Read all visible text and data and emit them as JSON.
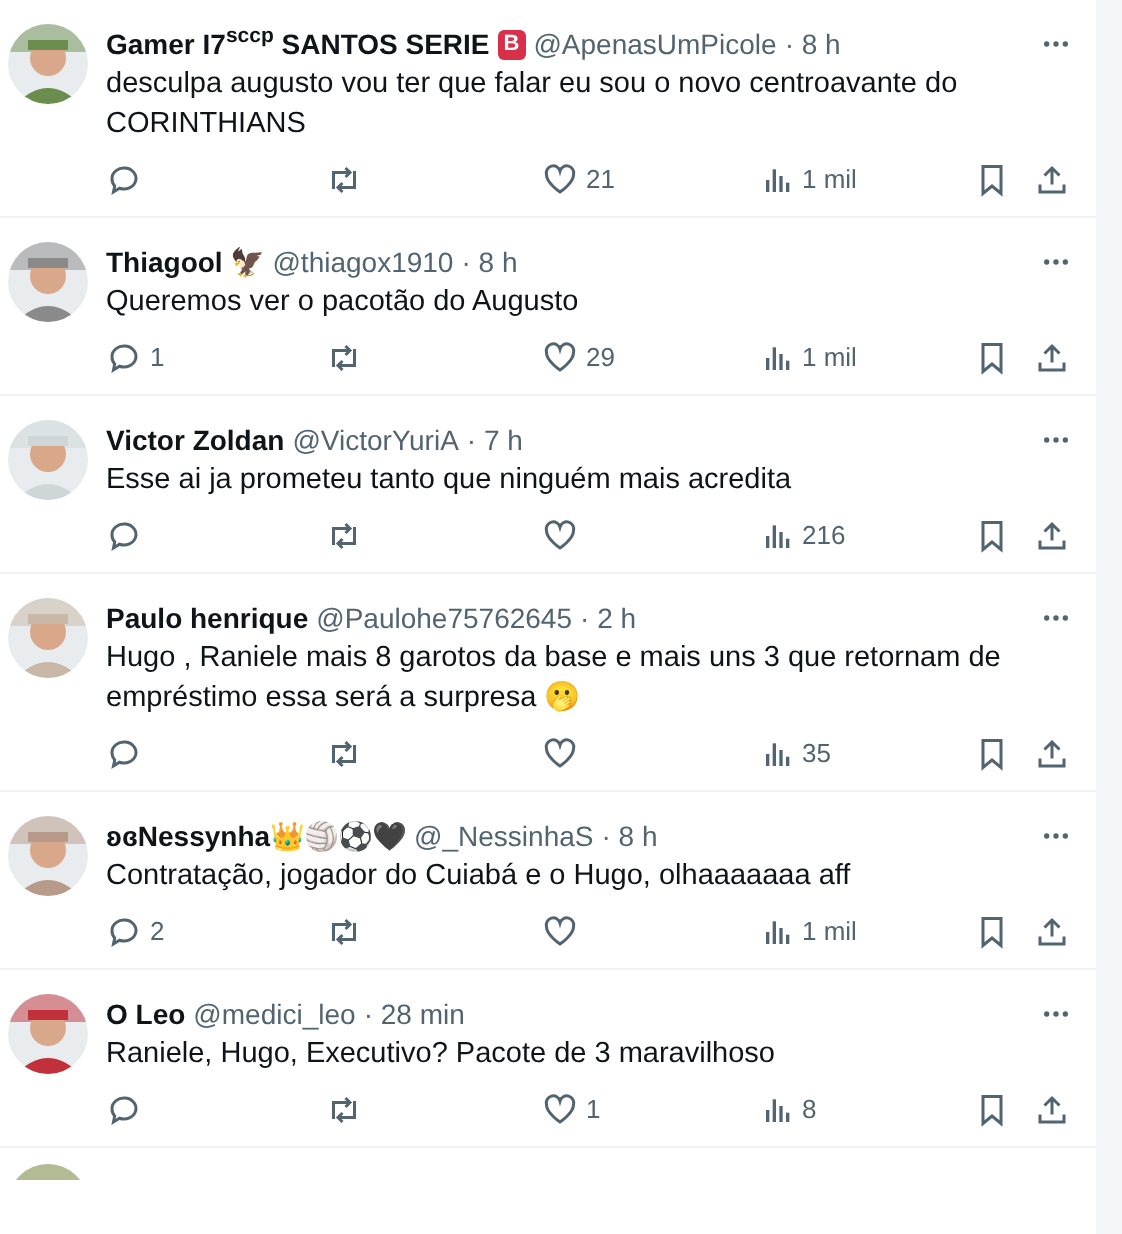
{
  "tweets": [
    {
      "kind": "full",
      "name": "Gamer I7$^{sccp}$ SANTOS SERIE",
      "badge": "B",
      "handle": "@ApenasUmPicole",
      "time": "· 8 h",
      "text": "desculpa augusto vou ter que falar eu sou o novo centroavante do CORINTHIANS",
      "likes": "21",
      "views": "1 mil"
    },
    {
      "kind": "full",
      "name": "Thiagool 🦅",
      "handle": "@thiagox1910",
      "time": "· 8 h",
      "text": "Queremos ver o pacotão do Augusto",
      "replies": "1",
      "likes": "29",
      "views": "1 mil"
    },
    {
      "kind": "full",
      "name": "Victor Zoldan",
      "handle": "@VictorYuriA",
      "time": "· 7 h",
      "text": "Esse ai ja prometeu tanto que ninguém mais acredita",
      "views": "216"
    },
    {
      "kind": "full",
      "name": "Paulo henrique",
      "handle": "@Paulohe75762645",
      "time": "· 2 h",
      "text": "Hugo , Raniele mais 8 garotos da base e mais uns 3 que retornam de empréstimo essa será  a surpresa 🫢",
      "views": "35"
    },
    {
      "kind": "full",
      "name": "ʚɞNessynha👑🏐⚽🖤",
      "handle": "@_NessinhaS",
      "time": "· 8 h",
      "text": "Contratação, jogador do Cuiabá e o Hugo, olhaaaaaaa aff",
      "replies": "2",
      "views": "1 mil"
    },
    {
      "kind": "full",
      "name": "O Leo",
      "handle": "@medici_leo",
      "time": "· 28 min",
      "text": "Raniele, Hugo, Executivo? Pacote de 3 maravilhoso",
      "likes": "1",
      "views": "8"
    },
    {
      "kind": "cut"
    }
  ]
}
